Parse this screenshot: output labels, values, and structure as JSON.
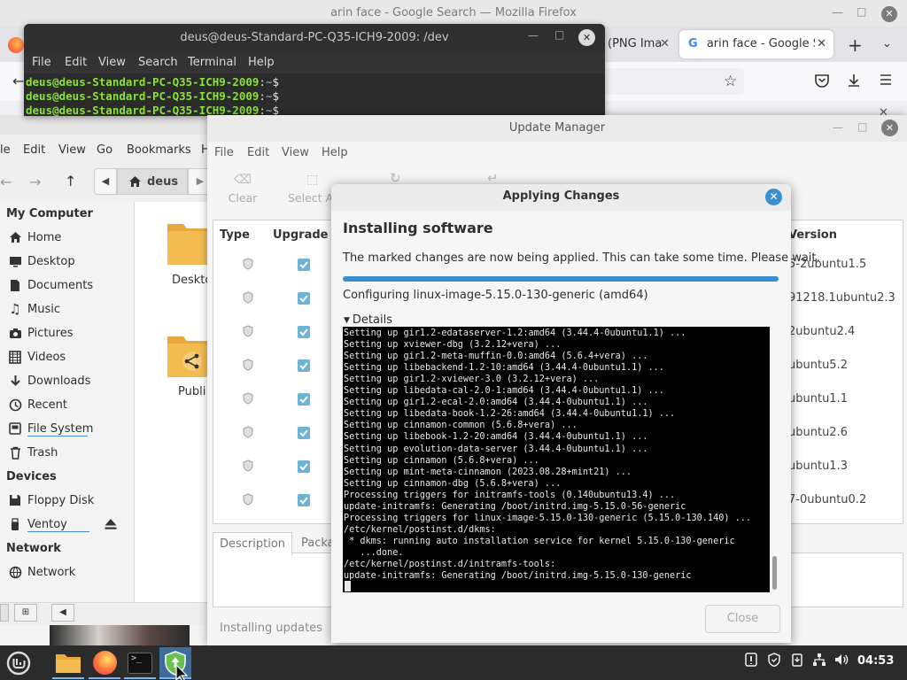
{
  "firefox": {
    "window_title": "arin face - Google Search — Mozilla Firefox",
    "tabs": [
      {
        "label": "(PNG Ima"
      },
      {
        "label": "arin face - Google Se"
      }
    ]
  },
  "terminal": {
    "title": "deus@deus-Standard-PC-Q35-ICH9-2009: /dev",
    "menu": [
      "File",
      "Edit",
      "View",
      "Search",
      "Terminal",
      "Help"
    ],
    "prompt_user": "deus@deus-Standard-PC-Q35-ICH9-2009",
    "prompt_path": "~",
    "prompt_symbol": "$"
  },
  "nemo": {
    "menu": [
      "le",
      "Edit",
      "View",
      "Go",
      "Bookmarks",
      "H"
    ],
    "path_button": "deus",
    "sidebar": {
      "my_computer_heading": "My Computer",
      "my_computer": [
        {
          "label": "Home",
          "icon": "home-icon"
        },
        {
          "label": "Desktop",
          "icon": "desktop-icon"
        },
        {
          "label": "Documents",
          "icon": "documents-icon"
        },
        {
          "label": "Music",
          "icon": "music-icon"
        },
        {
          "label": "Pictures",
          "icon": "camera-icon"
        },
        {
          "label": "Videos",
          "icon": "video-icon"
        },
        {
          "label": "Downloads",
          "icon": "download-icon"
        },
        {
          "label": "Recent",
          "icon": "clock-icon"
        },
        {
          "label": "File System",
          "icon": "drive-icon"
        },
        {
          "label": "Trash",
          "icon": "trash-icon"
        }
      ],
      "devices_heading": "Devices",
      "devices": [
        {
          "label": "Floppy Disk",
          "icon": "floppy-icon"
        },
        {
          "label": "Ventoy",
          "icon": "usb-icon"
        }
      ],
      "network_heading": "Network",
      "network": [
        {
          "label": "Network",
          "icon": "network-icon"
        }
      ]
    },
    "files": [
      {
        "label": "Deskto"
      },
      {
        "label": "Publi"
      }
    ]
  },
  "update_manager": {
    "title": "Update Manager",
    "menu": [
      "File",
      "Edit",
      "View",
      "Help"
    ],
    "toolbar": {
      "clear": "Clear",
      "select_all": "Select A"
    },
    "columns": {
      "type": "Type",
      "upgrade": "Upgrade",
      "version": "Version"
    },
    "versions": [
      "5-2ubuntu1.5",
      "91218.1ubuntu2.3",
      "2ubuntu2.4",
      "ubuntu5.2",
      "ubuntu1.1",
      "ubuntu2.6",
      "ubuntu1.3",
      "7-0ubuntu0.2"
    ],
    "tabs": {
      "description": "Description",
      "packages": "Packa"
    },
    "status": "Installing updates"
  },
  "dialog": {
    "title": "Applying Changes",
    "heading": "Installing software",
    "message": "The marked changes are now being applied. This can take some time. Please wait.",
    "progress": 1.0,
    "current_action": "Configuring linux-image-5.15.0-130-generic (amd64)",
    "details_label": "Details",
    "close_button": "Close",
    "log": [
      "Setting up gir1.2-edataserver-1.2:amd64 (3.44.4-0ubuntu1.1) ...",
      "Setting up xviewer-dbg (3.2.12+vera) ...",
      "Setting up gir1.2-meta-muffin-0.0:amd64 (5.6.4+vera) ...",
      "Setting up libebackend-1.2-10:amd64 (3.44.4-0ubuntu1.1) ...",
      "Setting up gir1.2-xviewer-3.0 (3.2.12+vera) ...",
      "Setting up libedata-cal-2.0-1:amd64 (3.44.4-0ubuntu1.1) ...",
      "Setting up gir1.2-ecal-2.0:amd64 (3.44.4-0ubuntu1.1) ...",
      "Setting up libedata-book-1.2-26:amd64 (3.44.4-0ubuntu1.1) ...",
      "Setting up cinnamon-common (5.6.8+vera) ...",
      "Setting up libebook-1.2-20:amd64 (3.44.4-0ubuntu1.1) ...",
      "Setting up evolution-data-server (3.44.4-0ubuntu1.1) ...",
      "Setting up cinnamon (5.6.8+vera) ...",
      "Setting up mint-meta-cinnamon (2023.08.28+mint21) ...",
      "Setting up cinnamon-dbg (5.6.8+vera) ...",
      "Processing triggers for initramfs-tools (0.140ubuntu13.4) ...",
      "update-initramfs: Generating /boot/initrd.img-5.15.0-56-generic",
      "Processing triggers for linux-image-5.15.0-130-generic (5.15.0-130.140) ...",
      "/etc/kernel/postinst.d/dkms:",
      " * dkms: running auto installation service for kernel 5.15.0-130-generic",
      "   ...done.",
      "/etc/kernel/postinst.d/initramfs-tools:",
      "update-initramfs: Generating /boot/initrd.img-5.15.0-130-generic"
    ]
  },
  "taskbar": {
    "clock": "04:53",
    "apps": [
      "menu-icon",
      "files-icon",
      "firefox-icon",
      "terminal-icon",
      "update-manager-icon"
    ]
  },
  "colors": {
    "accent": "#3a8fd0",
    "taskbar": "#2b2b2b",
    "terminal_bg": "#2b2b2b",
    "terminal_prompt": "#8ae234"
  }
}
